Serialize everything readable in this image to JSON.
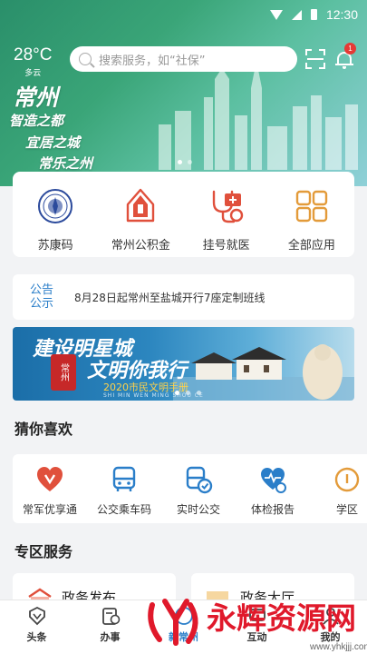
{
  "status_bar": {
    "time": "12:30"
  },
  "weather": {
    "temperature": "28°C",
    "condition": "多云"
  },
  "search": {
    "placeholder": "搜索服务，如“社保”"
  },
  "notifications": {
    "count": "1"
  },
  "banner": {
    "title": "常州",
    "line1": "智造之都",
    "line2": "宜居之城",
    "line3": "常乐之州"
  },
  "quick_services": [
    {
      "label": "苏康码",
      "icon": "seal-emblem-icon"
    },
    {
      "label": "常州公积金",
      "icon": "housing-fund-icon"
    },
    {
      "label": "挂号就医",
      "icon": "stethoscope-icon"
    },
    {
      "label": "全部应用",
      "icon": "grid-apps-icon"
    }
  ],
  "notice": {
    "tag_line1": "公告",
    "tag_line2": "公示",
    "text": "8月28日起常州至盐城开行7座定制班线"
  },
  "promo": {
    "line1": "建设明星城",
    "line2": "文明你我行",
    "line3": "2020市民文明手册",
    "line4": "SHI MIN WEN MING SHOU CE",
    "seal": "常州"
  },
  "guess": {
    "title": "猜你喜欢",
    "items": [
      {
        "label": "常军优享通",
        "icon": "military-heart-icon"
      },
      {
        "label": "公交乘车码",
        "icon": "bus-icon"
      },
      {
        "label": "实时公交",
        "icon": "realtime-bus-icon"
      },
      {
        "label": "体检报告",
        "icon": "health-report-icon"
      },
      {
        "label": "学区",
        "icon": "school-district-icon"
      }
    ]
  },
  "zones": {
    "title": "专区服务",
    "items": [
      {
        "label": "政务发布"
      },
      {
        "label": "政务大厅"
      }
    ]
  },
  "tabbar": [
    {
      "label": "头条",
      "icon": "headline-icon"
    },
    {
      "label": "办事",
      "icon": "service-icon"
    },
    {
      "label": "新常州",
      "icon": "city-icon"
    },
    {
      "label": "互动",
      "icon": "interact-icon"
    },
    {
      "label": "我的",
      "icon": "profile-icon"
    }
  ],
  "watermark": {
    "text": "永辉资源网",
    "url": "www.yhkjjj.com"
  },
  "colors": {
    "accent": "#2a7ec9",
    "brand_green": "#3aa578",
    "icon_red": "#e0503c",
    "badge": "#e53935"
  }
}
